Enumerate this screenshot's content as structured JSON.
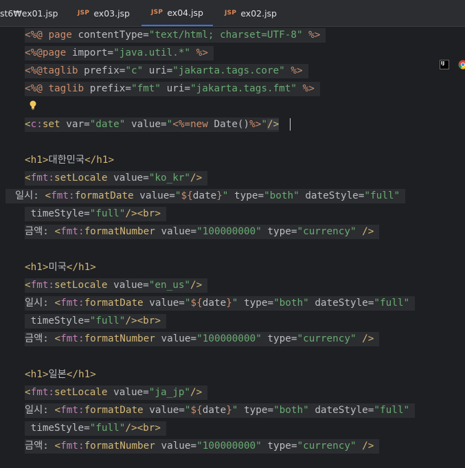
{
  "tabs": [
    {
      "badge": "",
      "label": "st6₩ex01.jsp"
    },
    {
      "badge": "JSP",
      "label": "ex03.jsp"
    },
    {
      "badge": "JSP",
      "label": "ex04.jsp"
    },
    {
      "badge": "JSP",
      "label": "ex02.jsp"
    }
  ],
  "active_tab": "ex04.jsp",
  "code": {
    "l1": {
      "a": "<%@ ",
      "b": "page",
      "c": " contentType=",
      "d": "\"text/html; charset=UTF-8\"",
      "e": " %>"
    },
    "l2": {
      "a": "<%@",
      "b": "page",
      "c": " import=",
      "d": "\"java.util.*\"",
      "e": " %>"
    },
    "l3": {
      "a": "<%@",
      "b": "taglib",
      "c": " prefix=",
      "d": "\"c\"",
      "e": " uri=",
      "f": "\"jakarta.tags.core\"",
      "g": " %>"
    },
    "l4": {
      "a": "<%@ ",
      "b": "taglib",
      "c": " prefix=",
      "d": "\"fmt\"",
      "e": " uri=",
      "f": "\"jakarta.tags.fmt\"",
      "g": " %>"
    },
    "l6": {
      "a": "<",
      "b": "c:",
      "c": "set",
      "d": " var=",
      "e": "\"date\"",
      "f": " value=",
      "g": "\"",
      "h": "<%=",
      "i": "new ",
      "j": "Date()",
      "k": "%>",
      "l": "\"",
      "m": "/>"
    },
    "s1": {
      "h1": {
        "open": "<h1>",
        "text": "대한민국",
        "close": "</h1>"
      },
      "setlocale": {
        "open": "<",
        "ns": "fmt:",
        "tag": "setLocale",
        "attr": " value=",
        "val": "\"ko_kr\"",
        "end": "/>"
      },
      "date": {
        "label": "일시: ",
        "open": "<",
        "ns": "fmt:",
        "tag": "formatDate",
        "a1": " value=",
        "v1a": "\"",
        "v1b": "${",
        "v1c": "date",
        "v1d": "}",
        "v1e": "\"",
        "a2": " type=",
        "v2": "\"both\"",
        "a3": " dateStyle=",
        "v3": "\"full\""
      },
      "time": {
        "a": " timeStyle=",
        "v": "\"full\"",
        "end": "/>",
        "br": "<br>"
      },
      "amount": {
        "label": "금액: ",
        "open": "<",
        "ns": "fmt:",
        "tag": "formatNumber",
        "a1": " value=",
        "v1": "\"100000000\"",
        "a2": " type=",
        "v2": "\"currency\"",
        "end": " />"
      }
    },
    "s2": {
      "h1": {
        "open": "<h1>",
        "text": "미국",
        "close": "</h1>"
      },
      "setlocale": {
        "open": "<",
        "ns": "fmt:",
        "tag": "setLocale",
        "attr": " value=",
        "val": "\"en_us\"",
        "end": "/>"
      },
      "date": {
        "label": "일시: ",
        "open": "<",
        "ns": "fmt:",
        "tag": "formatDate",
        "a1": " value=",
        "v1a": "\"",
        "v1b": "${",
        "v1c": "date",
        "v1d": "}",
        "v1e": "\"",
        "a2": " type=",
        "v2": "\"both\"",
        "a3": " dateStyle=",
        "v3": "\"full\""
      },
      "time": {
        "a": " timeStyle=",
        "v": "\"full\"",
        "end": "/>",
        "br": "<br>"
      },
      "amount": {
        "label": "금액: ",
        "open": "<",
        "ns": "fmt:",
        "tag": "formatNumber",
        "a1": " value=",
        "v1": "\"100000000\"",
        "a2": " type=",
        "v2": "\"currency\"",
        "end": " />"
      }
    },
    "s3": {
      "h1": {
        "open": "<h1>",
        "text": "일본",
        "close": "</h1>"
      },
      "setlocale": {
        "open": "<",
        "ns": "fmt:",
        "tag": "setLocale",
        "attr": " value=",
        "val": "\"ja_jp\"",
        "end": "/>"
      },
      "date": {
        "label": "일시: ",
        "open": "<",
        "ns": "fmt:",
        "tag": "formatDate",
        "a1": " value=",
        "v1a": "\"",
        "v1b": "${",
        "v1c": "date",
        "v1d": "}",
        "v1e": "\"",
        "a2": " type=",
        "v2": "\"both\"",
        "a3": " dateStyle=",
        "v3": "\"full\""
      },
      "time": {
        "a": " timeStyle=",
        "v": "\"full\"",
        "end": "/>",
        "br": "<br>"
      },
      "amount": {
        "label": "금액: ",
        "open": "<",
        "ns": "fmt:",
        "tag": "formatNumber",
        "a1": " value=",
        "v1": "\"100000000\"",
        "a2": " type=",
        "v2": "\"currency\"",
        "end": " />"
      }
    }
  },
  "icons": {
    "intention": "lightbulb-icon",
    "ide_browser": "intellij-icon",
    "browser": "chrome-icon"
  },
  "colors": {
    "background": "#1e1f22",
    "tag": "#d5b778",
    "namespace": "#c77dbb",
    "keyword": "#cf8e6d",
    "string": "#6aab73",
    "active_tab_underline": "#3574f0"
  }
}
